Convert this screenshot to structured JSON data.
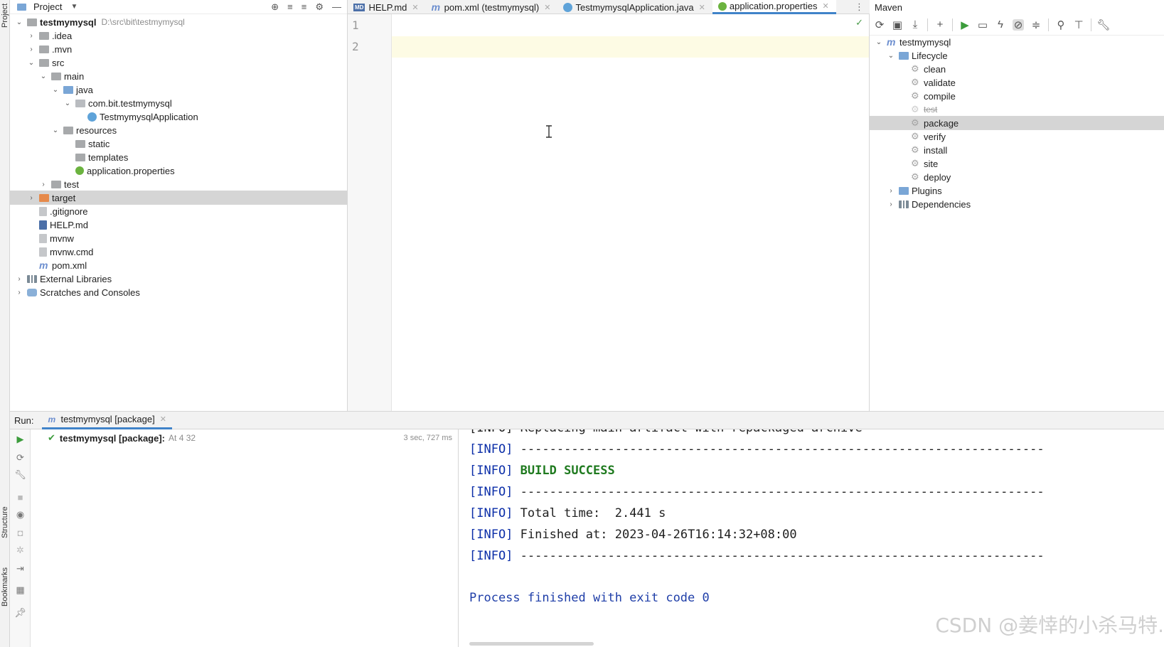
{
  "left_stripe": {
    "project_label": "Project",
    "structure_label": "Structure",
    "bookmarks_label": "Bookmarks"
  },
  "project": {
    "header_title": "Project",
    "rows": [
      {
        "label": "testmymysql",
        "hint": "D:\\src\\bit\\testmymysql"
      },
      {
        "label": ".idea"
      },
      {
        "label": ".mvn"
      },
      {
        "label": "src"
      },
      {
        "label": "main"
      },
      {
        "label": "java"
      },
      {
        "label": "com.bit.testmymysql"
      },
      {
        "label": "TestmymysqlApplication"
      },
      {
        "label": "resources"
      },
      {
        "label": "static"
      },
      {
        "label": "templates"
      },
      {
        "label": "application.properties"
      },
      {
        "label": "test"
      },
      {
        "label": "target"
      },
      {
        "label": ".gitignore"
      },
      {
        "label": "HELP.md"
      },
      {
        "label": "mvnw"
      },
      {
        "label": "mvnw.cmd"
      },
      {
        "label": "pom.xml"
      },
      {
        "label": "External Libraries"
      },
      {
        "label": "Scratches and Consoles"
      }
    ]
  },
  "tabs": [
    {
      "label": "HELP.md",
      "badge": "MD"
    },
    {
      "label": "pom.xml (testmymysql)"
    },
    {
      "label": "TestmymysqlApplication.java"
    },
    {
      "label": "application.properties"
    }
  ],
  "editor": {
    "line_numbers": [
      "1",
      "2"
    ]
  },
  "maven": {
    "title": "Maven",
    "root": "testmymysql",
    "lifecycle_label": "Lifecycle",
    "goals": [
      "clean",
      "validate",
      "compile",
      "test",
      "package",
      "verify",
      "install",
      "site",
      "deploy"
    ],
    "plugins_label": "Plugins",
    "dependencies_label": "Dependencies"
  },
  "run": {
    "label": "Run:",
    "tab_label": "testmymysql [package]",
    "tree_item": "testmymysql [package]:",
    "tree_item_time": "At 4 32",
    "duration": "3 sec, 727 ms",
    "console": {
      "partial": "[INFO] Replacing main artifact with repackaged archive",
      "tag": "[INFO]",
      "dashes": "------------------------------------------------------------------------",
      "build_success": "BUILD SUCCESS",
      "total_time": "Total time:  2.441 s",
      "finished_at": "Finished at: 2023-04-26T16:14:32+08:00",
      "process_finished": "Process finished with exit code 0"
    }
  },
  "watermark": "CSDN @姜悻的小杀马特."
}
